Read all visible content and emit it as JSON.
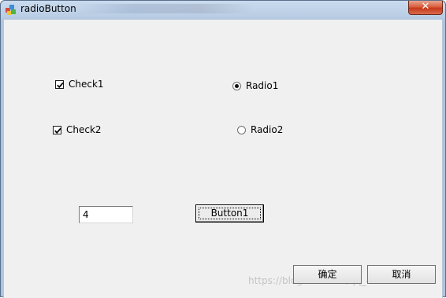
{
  "window": {
    "title": "radioButton"
  },
  "checkboxes": [
    {
      "label": "Check1",
      "checked": true
    },
    {
      "label": "Check2",
      "checked": true
    }
  ],
  "radios": [
    {
      "label": "Radio1",
      "selected": true
    },
    {
      "label": "Radio2",
      "selected": false
    }
  ],
  "edit": {
    "value": "4"
  },
  "buttons": {
    "button1": "Button1",
    "ok": "确定",
    "cancel": "取消"
  },
  "titlebar": {
    "close_glyph": "✕"
  },
  "watermark": {
    "text": "https://blog.csdn.net/qq_40096467"
  },
  "colors": {
    "client_bg": "#f0f0f0",
    "close_button": "#c7391a",
    "title_bar": "#b9cde4"
  },
  "icons": {
    "app": "app-icon",
    "close": "close-icon",
    "check": "checkmark-icon"
  }
}
